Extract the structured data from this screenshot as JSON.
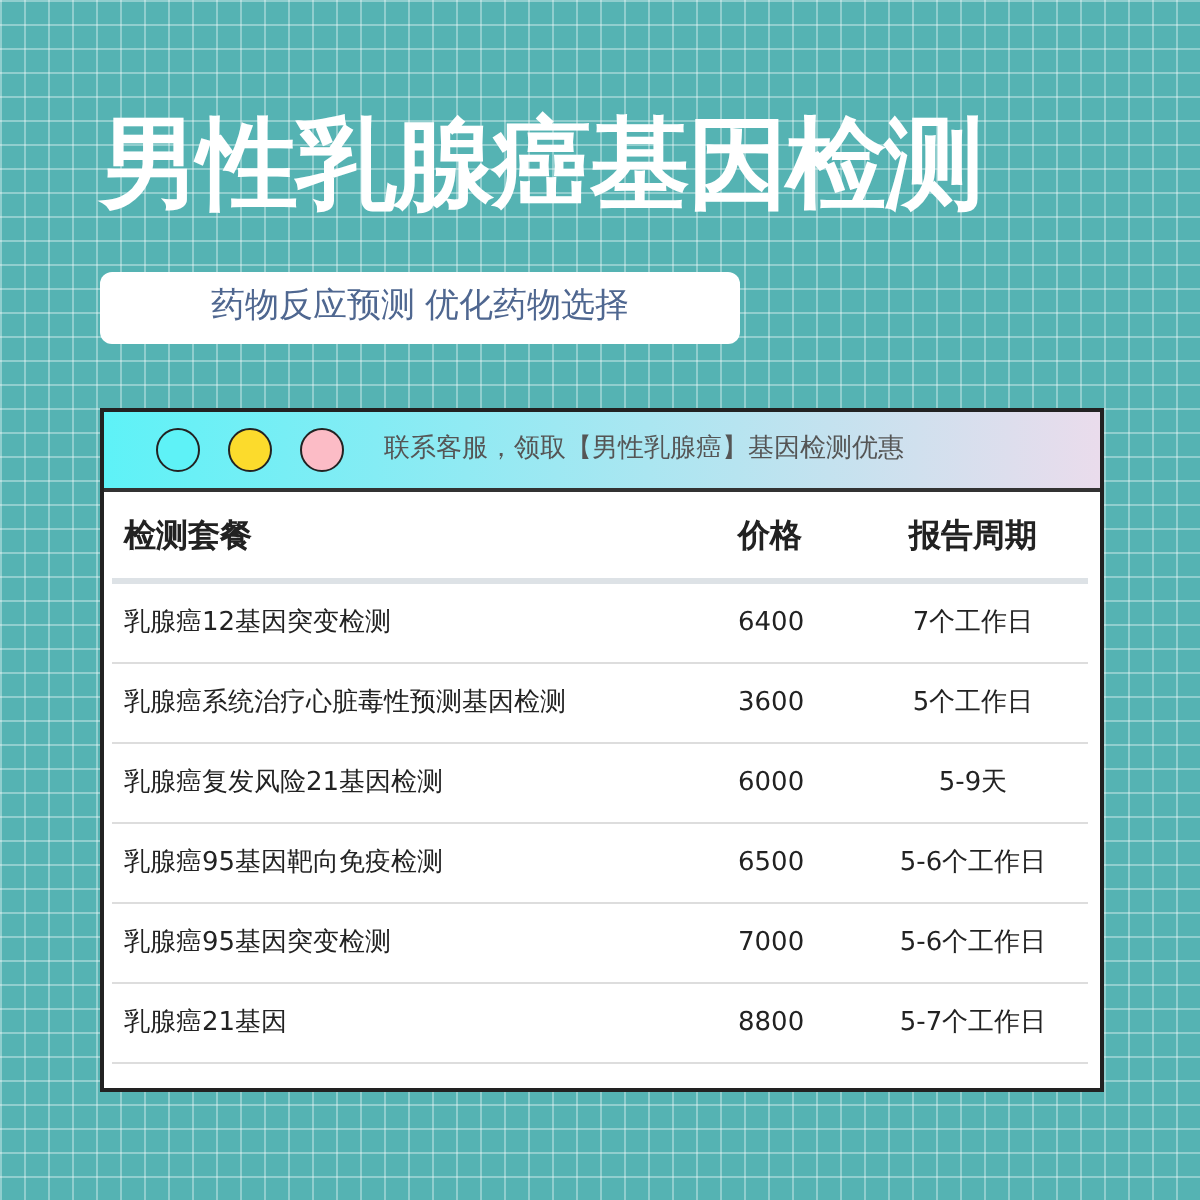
{
  "title": "男性乳腺癌基因检测",
  "subtitle": "药物反应预测 优化药物选择",
  "window": {
    "dots": [
      {
        "color": "#5ef2f7"
      },
      {
        "color": "#fcdb2c"
      },
      {
        "color": "#fcbcc6"
      }
    ],
    "banner": "联系客服，领取【男性乳腺癌】基因检测优惠",
    "table": {
      "columns": [
        "检测套餐",
        "价格",
        "报告周期"
      ],
      "rows": [
        [
          "乳腺癌12基因突变检测",
          "6400",
          "7个工作日"
        ],
        [
          "乳腺癌系统治疗心脏毒性预测基因检测",
          "3600",
          "5个工作日"
        ],
        [
          "乳腺癌复发风险21基因检测",
          "6000",
          "5-9天"
        ],
        [
          "乳腺癌95基因靶向免疫检测",
          "6500",
          "5-6个工作日"
        ],
        [
          "乳腺癌95基因突变检测",
          "7000",
          "5-6个工作日"
        ],
        [
          "乳腺癌21基因",
          "8800",
          "5-7个工作日"
        ]
      ]
    }
  }
}
